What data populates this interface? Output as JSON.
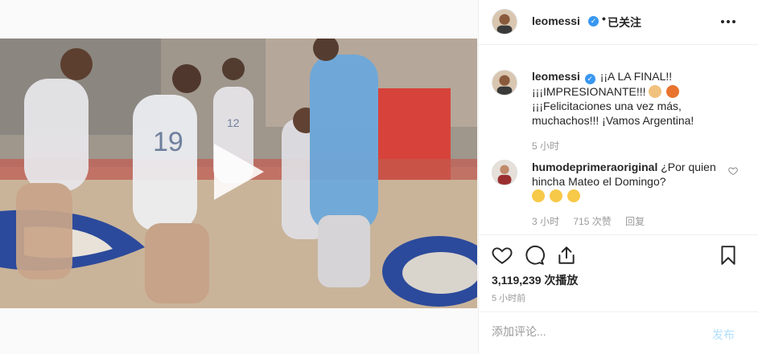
{
  "post": {
    "username": "leomessi",
    "separator": "•",
    "follow_label": "已关注"
  },
  "caption": {
    "username": "leomessi",
    "text": "¡¡A LA FINAL!! ¡¡¡IMPRESIONANTE!!! ",
    "text2": "¡¡¡Felicitaciones una vez más, muchachos!!! ¡Vamos Argentina!",
    "emojis": [
      "flexed-biceps-emoji",
      "basketball-emoji"
    ],
    "time": "5 小时"
  },
  "comment": {
    "username": "humodeprimeraoriginal",
    "text": " ¿Por quien hincha Mateo el Domingo?",
    "emojis": [
      "rofl-emoji",
      "rofl-emoji",
      "heart-eyes-emoji"
    ],
    "time": "3 小时",
    "likes": "715 次赞",
    "reply": "回复"
  },
  "stats": {
    "views": "3,119,239 次播放",
    "time_ago": "5 小时前"
  },
  "add_comment": {
    "placeholder": "添加评论...",
    "post_label": "发布"
  },
  "colors": {
    "verified": "#3897f0",
    "post_button_disabled": "#b2dffc",
    "jersey_blue": "#6aa9de"
  }
}
